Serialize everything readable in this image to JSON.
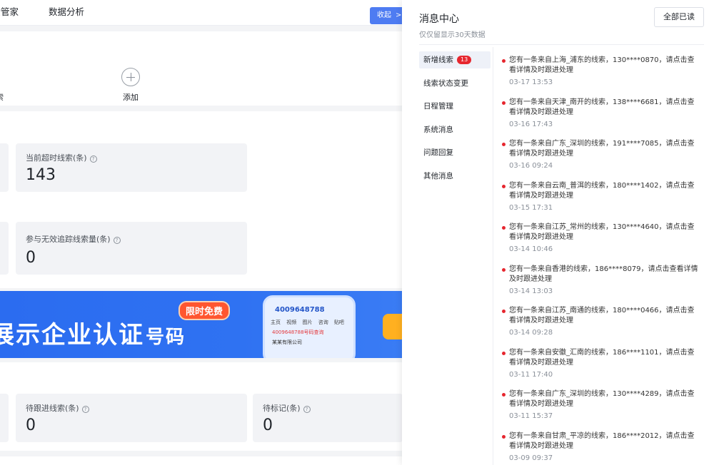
{
  "topbar": {
    "nav": [
      "线索管家",
      "数据分析"
    ],
    "collapse_label": "收起",
    "collapse_arrow": ">|"
  },
  "main": {
    "shortcut_left_label": "索",
    "add_label": "添加",
    "stats_row1": {
      "title": "当前超时线索(条)",
      "value": "143"
    },
    "stats_row2": {
      "title": "参与无效追踪线索量(条)",
      "value": "0"
    },
    "banner": {
      "headline": "展示企业认证",
      "headline_small": "号码",
      "tag": "限时免费",
      "phone_number": "4009648788",
      "phone_tabs": [
        "主页",
        "视频",
        "图片",
        "咨询",
        "贴吧"
      ],
      "phone_line": "4009648788号码查询",
      "phone_company": "某某有限公司"
    },
    "stats_row3": [
      {
        "title": "待跟进线索(条)",
        "value": "0"
      },
      {
        "title": "待标记(条)",
        "value": "0"
      }
    ]
  },
  "drawer": {
    "title": "消息中心",
    "subtitle": "仅仅留显示30天数据",
    "read_all": "全部已读",
    "categories": [
      {
        "label": "新增线索",
        "badge": "13",
        "active": true
      },
      {
        "label": "线索状态变更"
      },
      {
        "label": "日程管理"
      },
      {
        "label": "系统消息"
      },
      {
        "label": "问题回复"
      },
      {
        "label": "其他消息"
      }
    ],
    "messages": [
      {
        "text": "您有一条来自上海_浦东的线索，130****0870，请点击查看详情及时跟进处理",
        "time": "03-17 13:53"
      },
      {
        "text": "您有一条来自天津_南开的线索，138****6681，请点击查看详情及时跟进处理",
        "time": "03-16 17:43"
      },
      {
        "text": "您有一条来自广东_深圳的线索，191****7085，请点击查看详情及时跟进处理",
        "time": "03-16 09:24"
      },
      {
        "text": "您有一条来自云南_普洱的线索，180****1402，请点击查看详情及时跟进处理",
        "time": "03-15 17:31"
      },
      {
        "text": "您有一条来自江苏_常州的线索，130****4640，请点击查看详情及时跟进处理",
        "time": "03-14 10:46"
      },
      {
        "text": "您有一条来自香港的线索，186****8079，请点击查看详情及时跟进处理",
        "time": "03-14 13:03"
      },
      {
        "text": "您有一条来自江苏_南通的线索，180****0466，请点击查看详情及时跟进处理",
        "time": "03-14 09:28"
      },
      {
        "text": "您有一条来自安徽_汇南的线索，186****1101，请点击查看详情及时跟进处理",
        "time": "03-11 17:40"
      },
      {
        "text": "您有一条来自广东_深圳的线索，130****4289，请点击查看详情及时跟进处理",
        "time": "03-11 15:37"
      },
      {
        "text": "您有一条来自甘肃_平凉的线索，186****2012，请点击查看详情及时跟进处理",
        "time": "03-09 09:37"
      }
    ]
  }
}
